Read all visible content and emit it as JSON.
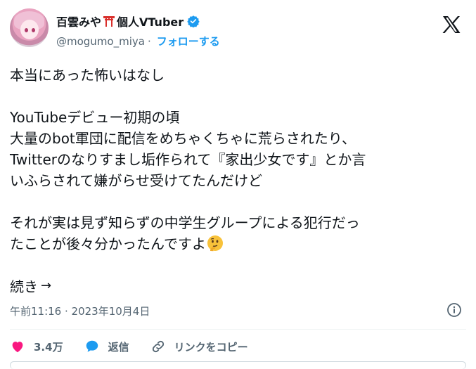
{
  "author": {
    "display_name": "百雲みや",
    "display_name_suffix": "個人VTuber",
    "handle": "@mogumo_miya",
    "separator": "·",
    "follow_label": "フォローする"
  },
  "tweet": {
    "lines": [
      "本当にあった怖いはなし",
      "",
      "YouTubeデビュー初期の頃",
      "大量のbot軍団に配信をめちゃくちゃに荒らされたり、",
      "Twitterのなりすまし垢作られて『家出少女です』とか言",
      "いふらされて嫌がらせ受けてたんだけど",
      "",
      "それが実は見ず知らずの中学生グループによる犯行だっ",
      "たことが後々分かったんですよ"
    ],
    "more_label": "続き",
    "timestamp": "午前11:16 · 2023年10月4日"
  },
  "actions": {
    "likes": "3.4万",
    "reply_label": "返信",
    "copy_link_label": "リンクをコピー"
  },
  "icons": {
    "like": "heart-icon",
    "reply": "speech-bubble-icon",
    "link": "link-icon",
    "info": "info-icon",
    "logo": "x-logo-icon",
    "verified": "verified-badge-icon",
    "torii": "torii-gate-icon",
    "emoji": "thinking-face-icon"
  },
  "colors": {
    "like": "#f91880",
    "reply": "#1d9bf0",
    "follow": "#1d9bf0",
    "secondary_text": "#536471"
  }
}
